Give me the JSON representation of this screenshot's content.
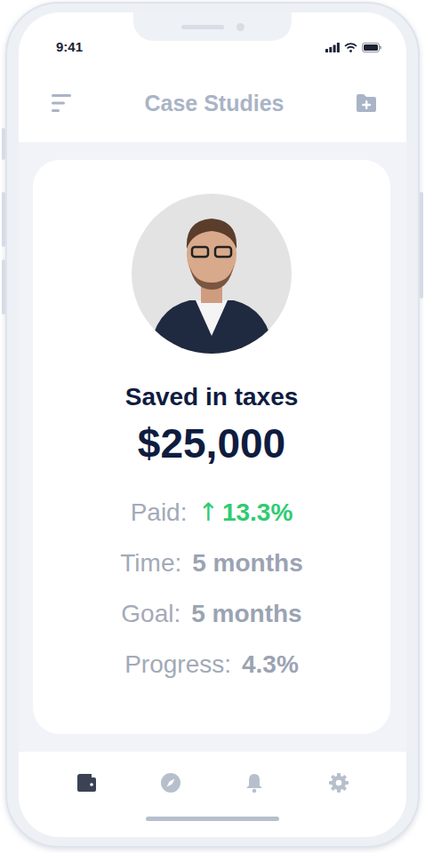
{
  "status_bar": {
    "time": "9:41"
  },
  "header": {
    "title": "Case Studies"
  },
  "card": {
    "heading": "Saved in taxes",
    "amount": "$25,000",
    "stats": [
      {
        "label": "Paid:",
        "value": "13.3%",
        "arrow": "↑",
        "kind": "trend"
      },
      {
        "label": "Time:",
        "value": "5 months",
        "kind": "plain"
      },
      {
        "label": "Goal:",
        "value": "5 months",
        "kind": "plain"
      },
      {
        "label": "Progress:",
        "value": "4.3%",
        "kind": "plain"
      }
    ]
  },
  "tab_bar": {
    "items": [
      {
        "selected": true
      },
      {
        "selected": false
      },
      {
        "selected": false
      },
      {
        "selected": false
      }
    ]
  }
}
